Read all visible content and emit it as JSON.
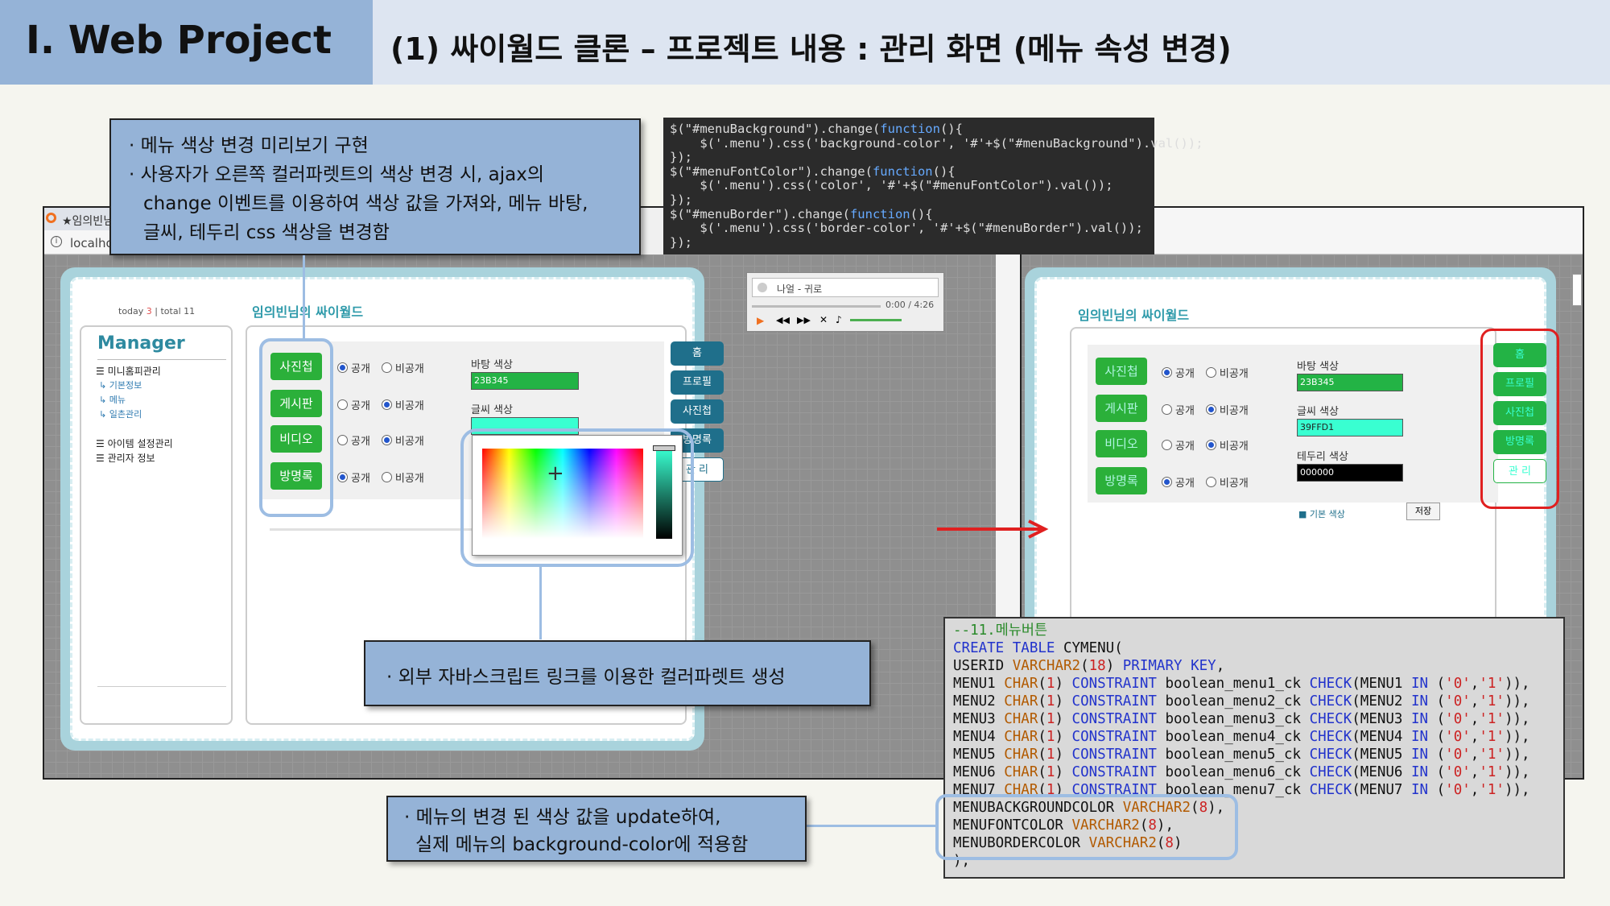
{
  "header": {
    "section_title": "Ⅰ. Web Project",
    "slide_title": "(1) 싸이월드 클론 – 프로젝트 내용 : 관리 화면 (메뉴 속성 변경)"
  },
  "browser_left": {
    "tab_title": "★임의빈님",
    "url": "localho",
    "today_label": "today",
    "today_count": "3",
    "total_label": "total 11",
    "site_title": "임의빈님의 싸이월드",
    "manager_title": "Manager",
    "nav": [
      {
        "label": "미니홈피관리",
        "kind": "group"
      },
      {
        "label": "기본정보",
        "kind": "sub"
      },
      {
        "label": "메뉴",
        "kind": "sub"
      },
      {
        "label": "일촌관리",
        "kind": "sub"
      },
      {
        "label": "아이템 설정관리",
        "kind": "group"
      },
      {
        "label": "관리자 정보",
        "kind": "group"
      }
    ],
    "menu_rows": [
      {
        "label": "사진첩",
        "open": "공개",
        "closed": "비공개",
        "selected": "open"
      },
      {
        "label": "게시판",
        "open": "공개",
        "closed": "비공개",
        "selected": "closed"
      },
      {
        "label": "비디오",
        "open": "공개",
        "closed": "비공개",
        "selected": "closed"
      },
      {
        "label": "방명록",
        "open": "공개",
        "closed": "비공개",
        "selected": "open"
      }
    ],
    "bg_color_label": "바탕 색상",
    "bg_color_value": "23B345",
    "font_color_label": "글씨 색상",
    "font_color_value": "39FFD1",
    "side_tabs": [
      "홈",
      "프로필",
      "사진첩",
      "방명록",
      "관 리"
    ],
    "player": {
      "song": "나얼 - 귀로",
      "time": "0:00 / 4:26"
    }
  },
  "browser_right": {
    "site_title": "임의빈님의 싸이월드",
    "menu_rows": [
      {
        "label": "사진첩",
        "open": "공개",
        "closed": "비공개",
        "selected": "open"
      },
      {
        "label": "게시판",
        "open": "공개",
        "closed": "비공개",
        "selected": "closed"
      },
      {
        "label": "비디오",
        "open": "공개",
        "closed": "비공개",
        "selected": "closed"
      },
      {
        "label": "방명록",
        "open": "공개",
        "closed": "비공개",
        "selected": "open"
      }
    ],
    "bg_color_label": "바탕 색상",
    "bg_color_value": "23B345",
    "font_color_label": "글씨 색상",
    "font_color_value": "39FFD1",
    "border_color_label": "테두리 색상",
    "border_color_value": "000000",
    "default_color_label": "기본 색상",
    "save_label": "저장",
    "side_tabs": [
      "홈",
      "프로필",
      "사진첩",
      "방명록",
      "관 리"
    ]
  },
  "callouts": {
    "top_line1": "· 메뉴 색상 변경 미리보기 구현",
    "top_line2": "· 사용자가 오른쪽 컬러파렛트의 색상 변경 시, ajax의",
    "top_line3": "change 이벤트를 이용하여 색상 값을 가져와, 메뉴 바탕,",
    "top_line4": "글씨, 테두리 css 색상을 변경함",
    "middle": "· 외부 자바스크립트 링크를 이용한 컬러파렛트 생성",
    "bottom_line1": "· 메뉴의  변경 된 색상 값을 update하여,",
    "bottom_line2": "실제 메뉴의 background-color에 적용함"
  },
  "code_js": [
    "$(\"#menuBackground\").change(function(){",
    "    $('.menu').css('background-color', '#'+$(\"#menuBackground\").val());",
    "});",
    "$(\"#menuFontColor\").change(function(){",
    "    $('.menu').css('color', '#'+$(\"#menuFontColor\").val());",
    "});",
    "$(\"#menuBorder\").change(function(){",
    "    $('.menu').css('border-color', '#'+$(\"#menuBorder\").val());",
    "});"
  ],
  "code_sql": [
    "--11.메뉴버튼",
    "CREATE TABLE CYMENU(",
    "USERID VARCHAR2(18) PRIMARY KEY,",
    "MENU1 CHAR(1) CONSTRAINT boolean_menu1_ck CHECK(MENU1 IN ('0','1')),",
    "MENU2 CHAR(1) CONSTRAINT boolean_menu2_ck CHECK(MENU2 IN ('0','1')),",
    "MENU3 CHAR(1) CONSTRAINT boolean_menu3_ck CHECK(MENU3 IN ('0','1')),",
    "MENU4 CHAR(1) CONSTRAINT boolean_menu4_ck CHECK(MENU4 IN ('0','1')),",
    "MENU5 CHAR(1) CONSTRAINT boolean_menu5_ck CHECK(MENU5 IN ('0','1')),",
    "MENU6 CHAR(1) CONSTRAINT boolean_menu6_ck CHECK(MENU6 IN ('0','1')),",
    "MENU7 CHAR(1) CONSTRAINT boolean_menu7_ck CHECK(MENU7 IN ('0','1')),",
    "MENUBACKGROUNDCOLOR VARCHAR2(8),",
    "MENUFONTCOLOR VARCHAR2(8),",
    "MENUBORDERCOLOR VARCHAR2(8)",
    ");"
  ],
  "colors": {
    "header_left": "#95b3d7",
    "header_right": "#dde5f1",
    "menu_green": "#2bb03a",
    "tab_teal": "#1f6f8b",
    "highlight_blue": "#9dbde3",
    "arrow_red": "#e02020"
  }
}
